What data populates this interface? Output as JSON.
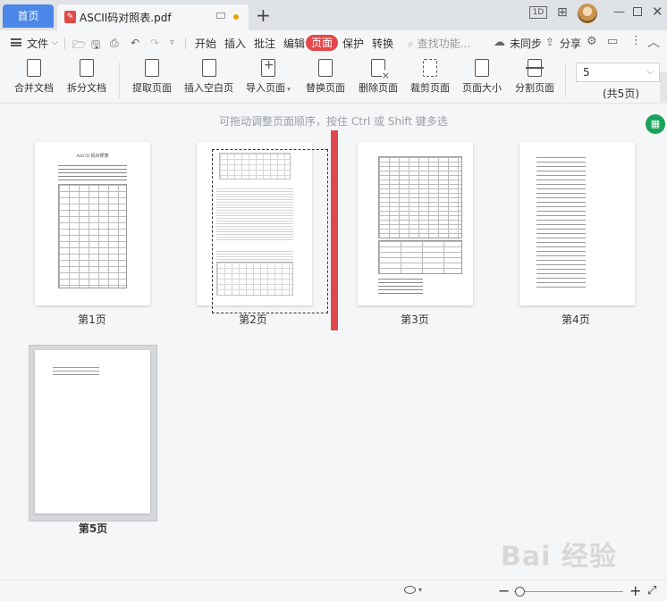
{
  "tabs": {
    "home": "首页",
    "file_name": "ASCII码对照表.pdf"
  },
  "window": {
    "mode_badge": "1D"
  },
  "menu": {
    "file": "文件",
    "items": [
      "开始",
      "插入",
      "批注",
      "编辑",
      "页面",
      "保护",
      "转换"
    ],
    "active": "页面",
    "search_placeholder": "查找功能...",
    "unsync": "未同步",
    "share": "分享"
  },
  "toolbar": {
    "merge": "合并文档",
    "split_doc": "拆分文档",
    "extract": "提取页面",
    "insert_blank": "插入空白页",
    "import": "导入页面",
    "replace": "替换页面",
    "delete": "删除页面",
    "crop": "裁剪页面",
    "page_size": "页面大小",
    "split_page": "分割页面",
    "page_input": "5",
    "page_total": "(共5页)"
  },
  "main": {
    "hint": "可拖动调整页面顺序，按住 Ctrl 或 Shift 键多选",
    "page1_title": "ASCII 码对照表",
    "pages": [
      "第1页",
      "第2页",
      "第3页",
      "第4页",
      "第5页"
    ],
    "selected_page": 5
  },
  "watermark": "Bai 经验",
  "colors": {
    "accent_blue": "#4a87e8",
    "accent_red": "#e5474b",
    "drop_indicator": "#e0474c",
    "green_action": "#1aa35a"
  }
}
